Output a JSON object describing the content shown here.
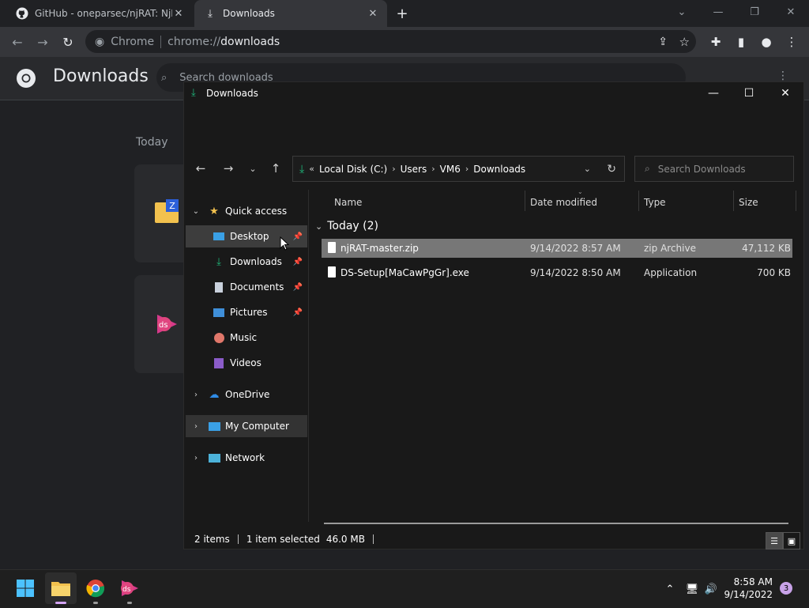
{
  "browser": {
    "tabs": [
      {
        "title": "GitHub - oneparsec/njRAT: NjRAT",
        "icon": "github-icon"
      },
      {
        "title": "Downloads",
        "icon": "download-icon"
      }
    ],
    "omnibox": {
      "chip": "Chrome",
      "url_scheme": "chrome://",
      "url_path": "downloads"
    }
  },
  "downloads_page": {
    "title": "Downloads",
    "search_placeholder": "Search downloads",
    "group_label": "Today"
  },
  "explorer": {
    "title": "Downloads",
    "breadcrumb": [
      "Local Disk (C:)",
      "Users",
      "VM6",
      "Downloads"
    ],
    "search_placeholder": "Search Downloads",
    "nav": {
      "quick_access": "Quick access",
      "items": [
        {
          "label": "Desktop",
          "icon": "desktop-icon",
          "pinned": true
        },
        {
          "label": "Downloads",
          "icon": "download-icon",
          "pinned": true
        },
        {
          "label": "Documents",
          "icon": "document-icon",
          "pinned": true
        },
        {
          "label": "Pictures",
          "icon": "pictures-icon",
          "pinned": true
        },
        {
          "label": "Music",
          "icon": "music-icon",
          "pinned": false
        },
        {
          "label": "Videos",
          "icon": "videos-icon",
          "pinned": false
        }
      ],
      "onedrive": "OneDrive",
      "my_computer": "My Computer",
      "network": "Network"
    },
    "columns": {
      "name": "Name",
      "date": "Date modified",
      "type": "Type",
      "size": "Size"
    },
    "group": "Today (2)",
    "files": [
      {
        "name": "njRAT-master.zip",
        "date": "9/14/2022 8:57 AM",
        "type": "zip Archive",
        "size": "47,112 KB",
        "selected": true
      },
      {
        "name": "DS-Setup[MaCawPgGr].exe",
        "date": "9/14/2022 8:50 AM",
        "type": "Application",
        "size": "700 KB",
        "selected": false
      }
    ],
    "status": {
      "items": "2 items",
      "selection": "1 item selected",
      "size": "46.0 MB"
    }
  },
  "taskbar": {
    "time": "8:58 AM",
    "date": "9/14/2022",
    "notifications": "3"
  },
  "colors": {
    "accent_green": "#1fb87b",
    "folder_yellow": "#f2c14e",
    "selection_gray": "#777777"
  }
}
